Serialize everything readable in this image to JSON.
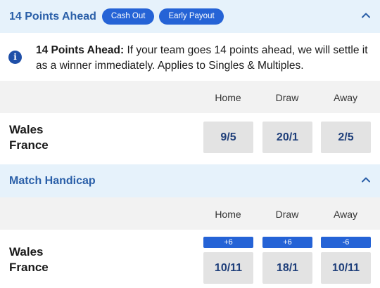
{
  "section1": {
    "title": "14 Points Ahead",
    "badges": [
      "Cash Out",
      "Early Payout"
    ],
    "chevron": "chevron-up-icon",
    "info": {
      "icon": "info-icon",
      "icon_glyph": "i",
      "bold": "14 Points Ahead:",
      "text": " If your team goes 14 points ahead, we will settle it as a winner immediately. Applies to Singles & Multiples."
    },
    "columns": [
      "Home",
      "Draw",
      "Away"
    ],
    "match": {
      "team1": "Wales",
      "team2": "France",
      "odds": [
        "9/5",
        "20/1",
        "2/5"
      ]
    }
  },
  "section2": {
    "title": "Match Handicap",
    "chevron": "chevron-up-icon",
    "columns": [
      "Home",
      "Draw",
      "Away"
    ],
    "match": {
      "team1": "Wales",
      "team2": "France",
      "handicaps": [
        "+6",
        "+6",
        "-6"
      ],
      "odds": [
        "10/11",
        "18/1",
        "10/11"
      ]
    }
  },
  "colors": {
    "header_bg": "#e6f2fb",
    "header_title": "#2a5fa8",
    "accent": "#2563d6",
    "odds_bg": "#e3e3e3",
    "odds_text": "#1f3f7a"
  }
}
